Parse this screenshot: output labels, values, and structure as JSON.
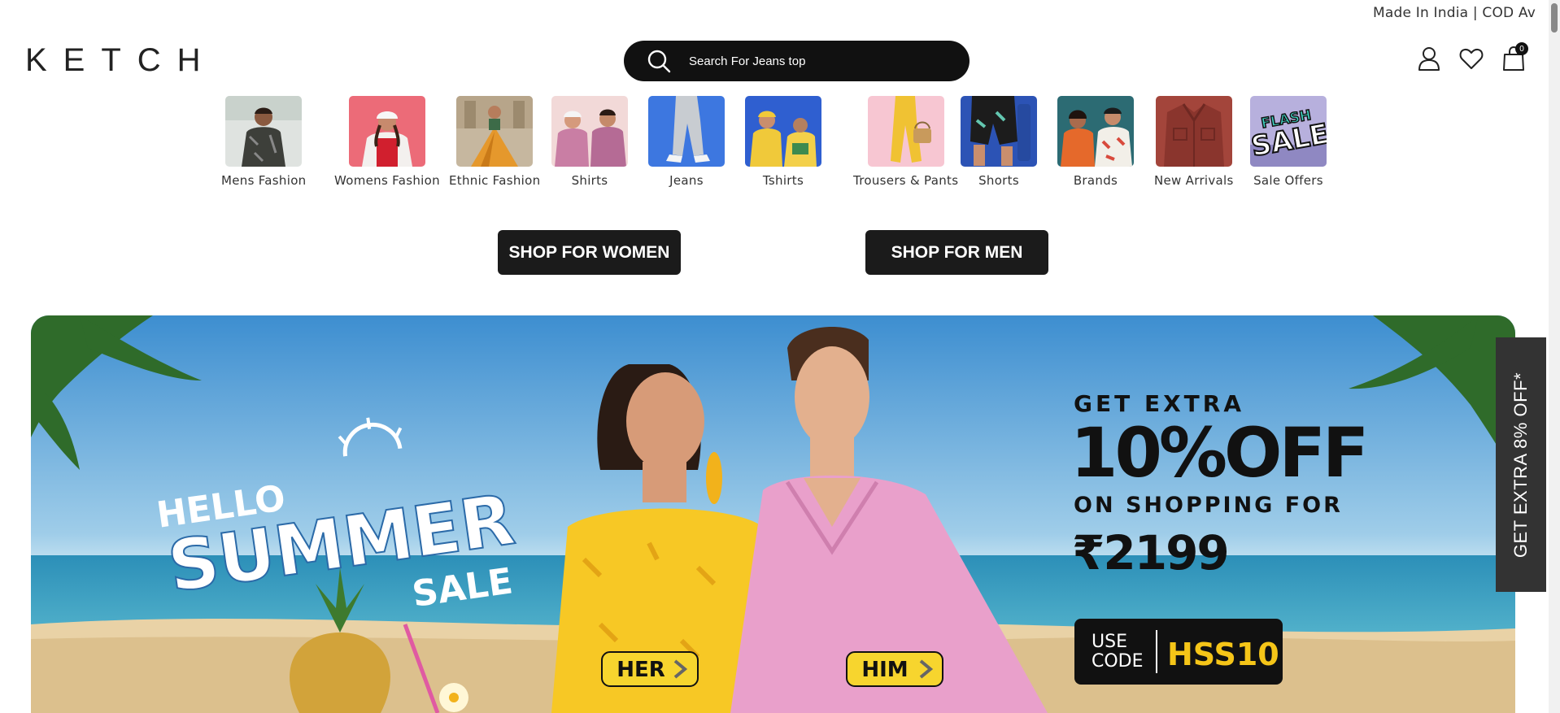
{
  "header": {
    "ticker": "Made In India | COD Av",
    "logo": "KETCH",
    "search_placeholder": "Search For Jeans top",
    "cart_count": "0"
  },
  "categories": [
    {
      "label": "Mens Fashion"
    },
    {
      "label": "Womens Fashion"
    },
    {
      "label": "Ethnic Fashion"
    },
    {
      "label": "Shirts"
    },
    {
      "label": "Jeans"
    },
    {
      "label": "Tshirts"
    },
    {
      "label": "Trousers & Pants"
    },
    {
      "label": "Shorts"
    },
    {
      "label": "Brands"
    },
    {
      "label": "New Arrivals"
    },
    {
      "label": "Sale Offers"
    }
  ],
  "shop_buttons": {
    "women": "SHOP FOR WOMEN",
    "men": "SHOP FOR MEN"
  },
  "hero": {
    "hello": "HELLO",
    "summer": "SUMMER",
    "sale": "SALE",
    "get_extra": "GET EXTRA",
    "discount": "10%OFF",
    "on_shopping": "ON SHOPPING FOR",
    "amount": "₹2199",
    "use": "USE",
    "code_label": "CODE",
    "code": "HSS10",
    "her": "HER",
    "him": "HIM"
  },
  "flash_sale": {
    "line1": "FLASH",
    "line2": "SALE"
  },
  "side_tab": "GET EXTRA 8% OFF*",
  "colors": {
    "dark": "#111111",
    "button": "#1b1b1b",
    "yellow_tag": "#f7d52e",
    "code_yellow": "#f5c518",
    "side_tab": "#333333"
  }
}
